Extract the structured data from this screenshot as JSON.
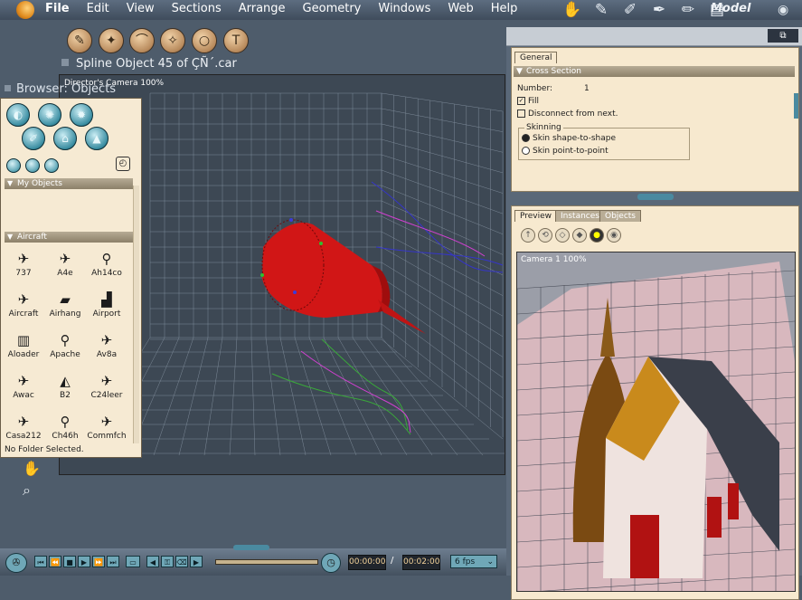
{
  "menu": {
    "items": [
      "File",
      "Edit",
      "View",
      "Sections",
      "Arrange",
      "Geometry",
      "Windows",
      "Web",
      "Help"
    ],
    "room": "Model"
  },
  "document": {
    "title": "Spline Object 45 of ÇÑ´.car"
  },
  "viewport": {
    "label": "Director's Camera 100%"
  },
  "browser": {
    "title": "Browser: Objects",
    "sections": {
      "my_objects": "My Objects",
      "aircraft": "Aircraft"
    },
    "objects": [
      {
        "label": "737",
        "icon": "jet-icon"
      },
      {
        "label": "A4e",
        "icon": "jet-icon"
      },
      {
        "label": "Ah14co",
        "icon": "helicopter-icon"
      },
      {
        "label": "Aircraft",
        "icon": "plane-icon"
      },
      {
        "label": "Airhang",
        "icon": "hangar-icon"
      },
      {
        "label": "Airport",
        "icon": "airport-icon"
      },
      {
        "label": "Aloader",
        "icon": "loader-icon"
      },
      {
        "label": "Apache",
        "icon": "helicopter-icon"
      },
      {
        "label": "Av8a",
        "icon": "jet-icon"
      },
      {
        "label": "Awac",
        "icon": "plane-icon"
      },
      {
        "label": "B2",
        "icon": "bomber-icon"
      },
      {
        "label": "C24leer",
        "icon": "jet-icon"
      },
      {
        "label": "Casa212",
        "icon": "plane-icon"
      },
      {
        "label": "Ch46h",
        "icon": "helicopter-icon"
      },
      {
        "label": "Commfch",
        "icon": "plane-icon"
      }
    ],
    "status": "No Folder Selected."
  },
  "properties": {
    "tab": "General",
    "section": "Cross Section",
    "number_label": "Number:",
    "number_value": "1",
    "fill_label": "Fill",
    "disconnect_label": "Disconnect from next.",
    "skinning_label": "Skinning",
    "skin_shape": "Skin shape-to-shape",
    "skin_point": "Skin point-to-point"
  },
  "preview": {
    "tabs": [
      "Preview",
      "Instances",
      "Objects"
    ],
    "camera_label": "Camera 1 100%"
  },
  "transport": {
    "current_time": "00:00:00",
    "separator": "/",
    "end_time": "00:02:00",
    "fps": "6 fps"
  },
  "colors": {
    "menubar": "#4f5e70",
    "panel": "#f7e9cf",
    "accent": "#6fa7b7",
    "model_red": "#d11616"
  }
}
